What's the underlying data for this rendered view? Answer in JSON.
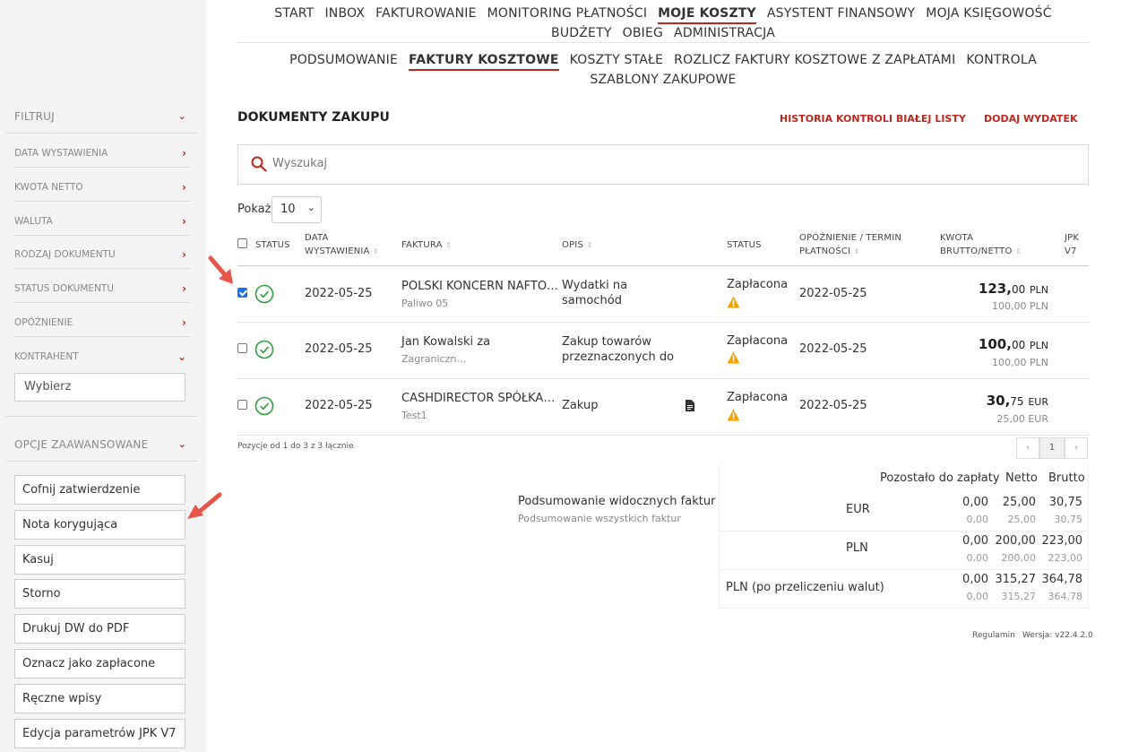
{
  "nav": {
    "main_row1": [
      "START",
      "INBOX",
      "FAKTUROWANIE",
      "MONITORING PŁATNOŚCI",
      "MOJE KOSZTY",
      "ASYSTENT FINANSOWY",
      "MOJA KSIĘGOWOŚĆ"
    ],
    "main_row2": [
      "BUDŻETY",
      "OBIEG",
      "ADMINISTRACJA"
    ],
    "sub_row1": [
      "PODSUMOWANIE",
      "FAKTURY KOSZTOWE",
      "KOSZTY STAŁE",
      "ROZLICZ FAKTURY KOSZTOWE Z ZAPŁATAMI",
      "KONTROLA"
    ],
    "sub_row2": [
      "SZABLONY ZAKUPOWE"
    ],
    "active_main": "MOJE KOSZTY",
    "active_sub": "FAKTURY KOSZTOWE"
  },
  "sidebar": {
    "filter_title": "FILTRUJ",
    "filters": [
      "DATA WYSTAWIENIA",
      "KWOTA NETTO",
      "WALUTA",
      "RODZAJ DOKUMENTU",
      "STATUS DOKUMENTU",
      "OPÓŹNIENIE",
      "KONTRAHENT"
    ],
    "contractor_placeholder": "Wybierz",
    "advanced_title": "OPCJE ZAAWANSOWANE",
    "actions": [
      "Cofnij zatwierdzenie",
      "Nota korygująca",
      "Kasuj",
      "Storno",
      "Drukuj DW do PDF",
      "Oznacz jako zapłacone",
      "Ręczne wpisy",
      "Edycja parametrów JPK V7"
    ]
  },
  "main": {
    "title": "DOKUMENTY ZAKUPU",
    "link_history": "HISTORIA KONTROLI BIAŁEJ LISTY",
    "link_add": "DODAJ WYDATEK",
    "search_placeholder": "Wyszukaj",
    "show_label": "Pokaż",
    "show_value": "10",
    "columns": {
      "status": "STATUS",
      "date_line1": "DATA",
      "date_line2": "WYSTAWIENIA",
      "invoice": "FAKTURA",
      "desc": "OPIS",
      "status2": "STATUS",
      "delay_line1": "OPÓŹNIENIE / TERMIN",
      "delay_line2": "PŁATNOŚCI",
      "amount_line1": "KWOTA",
      "amount_line2": "BRUTTO/NETTO",
      "jpk_line1": "JPK",
      "jpk_line2": "V7"
    },
    "rows": [
      {
        "checked": true,
        "date": "2022-05-25",
        "invoice": "POLSKI KONCERN NAFTO…",
        "invoice_sub": "Paliwo 05",
        "desc_line1": "Wydatki na",
        "desc_line2": "samochód",
        "status": "Zapłacona",
        "due": "2022-05-25",
        "gross_int": "123,",
        "gross_dec": "00",
        "gross_cur": "PLN",
        "net": "100,00 PLN",
        "has_doc": false
      },
      {
        "checked": false,
        "date": "2022-05-25",
        "invoice": "Jan Kowalski za",
        "invoice_sub": "Zagraniczn…",
        "desc_line1": "Zakup towarów",
        "desc_line2": "przeznaczonych do",
        "status": "Zapłacona",
        "due": "2022-05-25",
        "gross_int": "100,",
        "gross_dec": "00",
        "gross_cur": "PLN",
        "net": "100,00 PLN",
        "has_doc": false
      },
      {
        "checked": false,
        "date": "2022-05-25",
        "invoice": "CASHDIRECTOR SPÓŁKA…",
        "invoice_sub": "Test1",
        "desc_line1": "Zakup",
        "desc_line2": "",
        "status": "Zapłacona",
        "due": "2022-05-25",
        "gross_int": "30,",
        "gross_dec": "75",
        "gross_cur": "EUR",
        "net": "25,00 EUR",
        "has_doc": true
      }
    ],
    "positions_info": "Pozycje od 1 do 3 z 3 łącznie",
    "pager": {
      "prev": "‹",
      "page": "1",
      "next": "›"
    }
  },
  "summary": {
    "label_visible": "Podsumowanie widocznych faktur",
    "label_all": "Podsumowanie wszystkich faktur",
    "headers": {
      "remaining": "Pozostało do zapłaty",
      "net": "Netto",
      "gross": "Brutto"
    },
    "rows": [
      {
        "currency": "EUR",
        "remaining": "0,00",
        "net": "25,00",
        "gross": "30,75",
        "remaining_all": "0,00",
        "net_all": "25,00",
        "gross_all": "30,75"
      },
      {
        "currency": "PLN",
        "remaining": "0,00",
        "net": "200,00",
        "gross": "223,00",
        "remaining_all": "0,00",
        "net_all": "200,00",
        "gross_all": "223,00"
      },
      {
        "currency": "PLN (po przeliczeniu walut)",
        "remaining": "0,00",
        "net": "315,27",
        "gross": "364,78",
        "remaining_all": "0,00",
        "net_all": "315,27",
        "gross_all": "364,78"
      }
    ]
  },
  "footer": {
    "terms": "Regulamin",
    "version": "Wersja: v22.4.2.0"
  },
  "colors": {
    "accent": "#c0271f",
    "success": "#2e9e3e",
    "warning": "#f0a500",
    "arrow": "#e8554a"
  }
}
